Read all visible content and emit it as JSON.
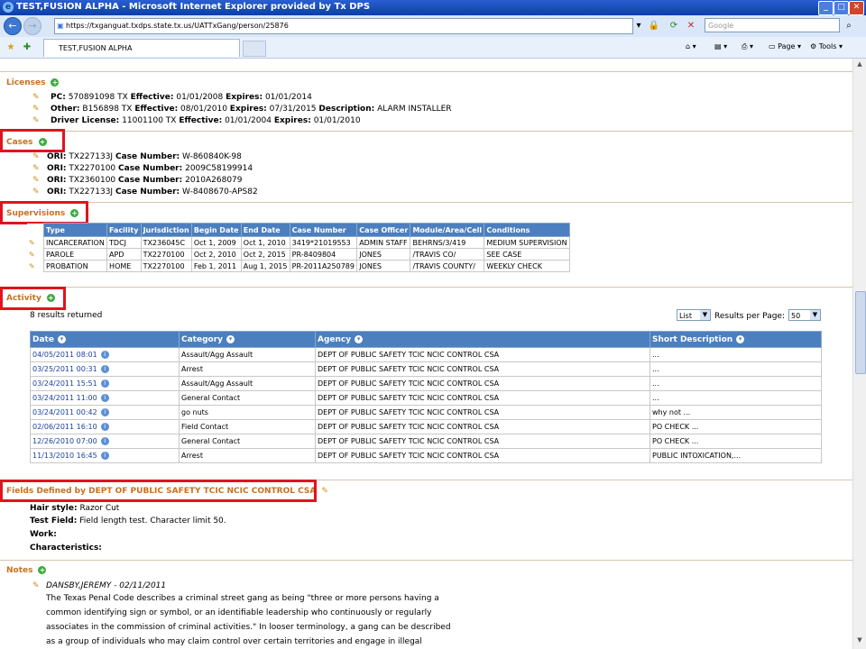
{
  "window": {
    "title": "TEST,FUSION ALPHA - Microsoft Internet Explorer provided by Tx DPS"
  },
  "address": {
    "url": "https://txganguat.txdps.state.tx.us/UATTxGang/person/25876",
    "search_placeholder": "Google"
  },
  "tab": {
    "label": "TEST,FUSION ALPHA"
  },
  "toolbar": {
    "page_label": "Page",
    "tools_label": "Tools"
  },
  "licenses": {
    "title": "Licenses",
    "items": [
      {
        "k1": "PC:",
        "v1": "570891098 TX",
        "k2": "Effective:",
        "v2": "01/01/2008",
        "k3": "Expires:",
        "v3": "01/01/2014",
        "k4": "",
        "v4": ""
      },
      {
        "k1": "Other:",
        "v1": "B156898 TX",
        "k2": "Effective:",
        "v2": "08/01/2010",
        "k3": "Expires:",
        "v3": "07/31/2015",
        "k4": "Description:",
        "v4": "ALARM INSTALLER"
      },
      {
        "k1": "Driver License:",
        "v1": "11001100 TX",
        "k2": "Effective:",
        "v2": "01/01/2004",
        "k3": "Expires:",
        "v3": "01/01/2010",
        "k4": "",
        "v4": ""
      }
    ]
  },
  "cases": {
    "title": "Cases",
    "items": [
      {
        "ori": "TX227133J",
        "case": "W-860840K-98"
      },
      {
        "ori": "TX2270100",
        "case": "2009C58199914"
      },
      {
        "ori": "TX2360100",
        "case": "2010A268079"
      },
      {
        "ori": "TX227133J",
        "case": "W-8408670-APS82"
      }
    ],
    "ori_label": "ORI:",
    "case_label": "Case Number:"
  },
  "supervisions": {
    "title": "Supervisions",
    "headers": [
      "Type",
      "Facility",
      "Jurisdiction",
      "Begin Date",
      "End Date",
      "Case Number",
      "Case Officer",
      "Module/Area/Cell",
      "Conditions"
    ],
    "rows": [
      [
        "INCARCERATION",
        "TDCJ",
        "TX236045C",
        "Oct 1, 2009",
        "Oct 1, 2010",
        "3419*21019553",
        "ADMIN STAFF",
        "BEHRNS/3/419",
        "MEDIUM SUPERVISION"
      ],
      [
        "PAROLE",
        "APD",
        "TX2270100",
        "Oct 2, 2010",
        "Oct 2, 2015",
        "PR-8409804",
        "JONES",
        "/TRAVIS CO/",
        "SEE CASE"
      ],
      [
        "PROBATION",
        "HOME",
        "TX2270100",
        "Feb 1, 2011",
        "Aug 1, 2015",
        "PR-2011A250789",
        "JONES",
        "/TRAVIS COUNTY/",
        "WEEKLY CHECK"
      ]
    ]
  },
  "activity": {
    "title": "Activity",
    "results": "8 results returned",
    "view_mode": "List",
    "per_page_label": "Results per Page:",
    "per_page": "50",
    "headers": [
      "Date",
      "Category",
      "Agency",
      "Short Description"
    ],
    "rows": [
      [
        "04/05/2011 08:01",
        "Assault/Agg Assault",
        "DEPT OF PUBLIC SAFETY TCIC NCIC CONTROL CSA",
        "..."
      ],
      [
        "03/25/2011 00:31",
        "Arrest",
        "DEPT OF PUBLIC SAFETY TCIC NCIC CONTROL CSA",
        "..."
      ],
      [
        "03/24/2011 15:51",
        "Assault/Agg Assault",
        "DEPT OF PUBLIC SAFETY TCIC NCIC CONTROL CSA",
        "..."
      ],
      [
        "03/24/2011 11:00",
        "General Contact",
        "DEPT OF PUBLIC SAFETY TCIC NCIC CONTROL CSA",
        "..."
      ],
      [
        "03/24/2011 00:42",
        "go nuts",
        "DEPT OF PUBLIC SAFETY TCIC NCIC CONTROL CSA",
        "why not ..."
      ],
      [
        "02/06/2011 16:10",
        "Field Contact",
        "DEPT OF PUBLIC SAFETY TCIC NCIC CONTROL CSA",
        "PO CHECK ..."
      ],
      [
        "12/26/2010 07:00",
        "General Contact",
        "DEPT OF PUBLIC SAFETY TCIC NCIC CONTROL CSA",
        "PO CHECK ..."
      ],
      [
        "11/13/2010 16:45",
        "Arrest",
        "DEPT OF PUBLIC SAFETY TCIC NCIC CONTROL CSA",
        "PUBLIC INTOXICATION,..."
      ]
    ]
  },
  "fields": {
    "title": "Fields Defined by DEPT OF PUBLIC SAFETY TCIC NCIC CONTROL CSA",
    "items": [
      {
        "label": "Hair style:",
        "value": "Razor Cut"
      },
      {
        "label": "Test Field:",
        "value": "Field length test. Character limit 50."
      },
      {
        "label": "Work:",
        "value": ""
      },
      {
        "label": "Characteristics:",
        "value": ""
      }
    ]
  },
  "notes": {
    "title": "Notes",
    "author": "DANSBY,JEREMY - 02/11/2011",
    "lines": [
      "The Texas Penal Code describes a criminal street gang as being \"three or more persons having a",
      "common identifying sign or symbol, or an identifiable leadership who continuously or regularly",
      "associates in the commission of criminal activities.\" In looser terminology, a gang can be described",
      "as a group of individuals who may claim control over certain territories and engage in illegal"
    ]
  }
}
